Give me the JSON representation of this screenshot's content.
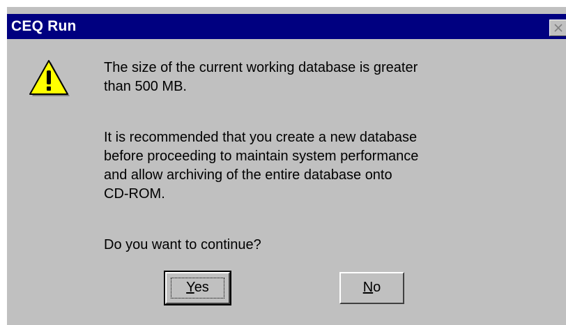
{
  "window": {
    "title": "CEQ Run"
  },
  "dialog": {
    "icon": "warning-icon",
    "message_line1": "The size of the current working database is greater",
    "message_line2": "than 500 MB.",
    "recommend_line1": "It is recommended that you create a new database",
    "recommend_line2": "before proceeding to maintain system performance",
    "recommend_line3": "and allow archiving of the entire database onto",
    "recommend_line4": "CD-ROM.",
    "question": "Do you want to continue?"
  },
  "buttons": {
    "yes_mnemonic": "Y",
    "yes_rest": "es",
    "no_mnemonic": "N",
    "no_rest": "o"
  },
  "colors": {
    "titlebar": "#000080",
    "face": "#c0c0c0",
    "warning": "#ffff00"
  }
}
